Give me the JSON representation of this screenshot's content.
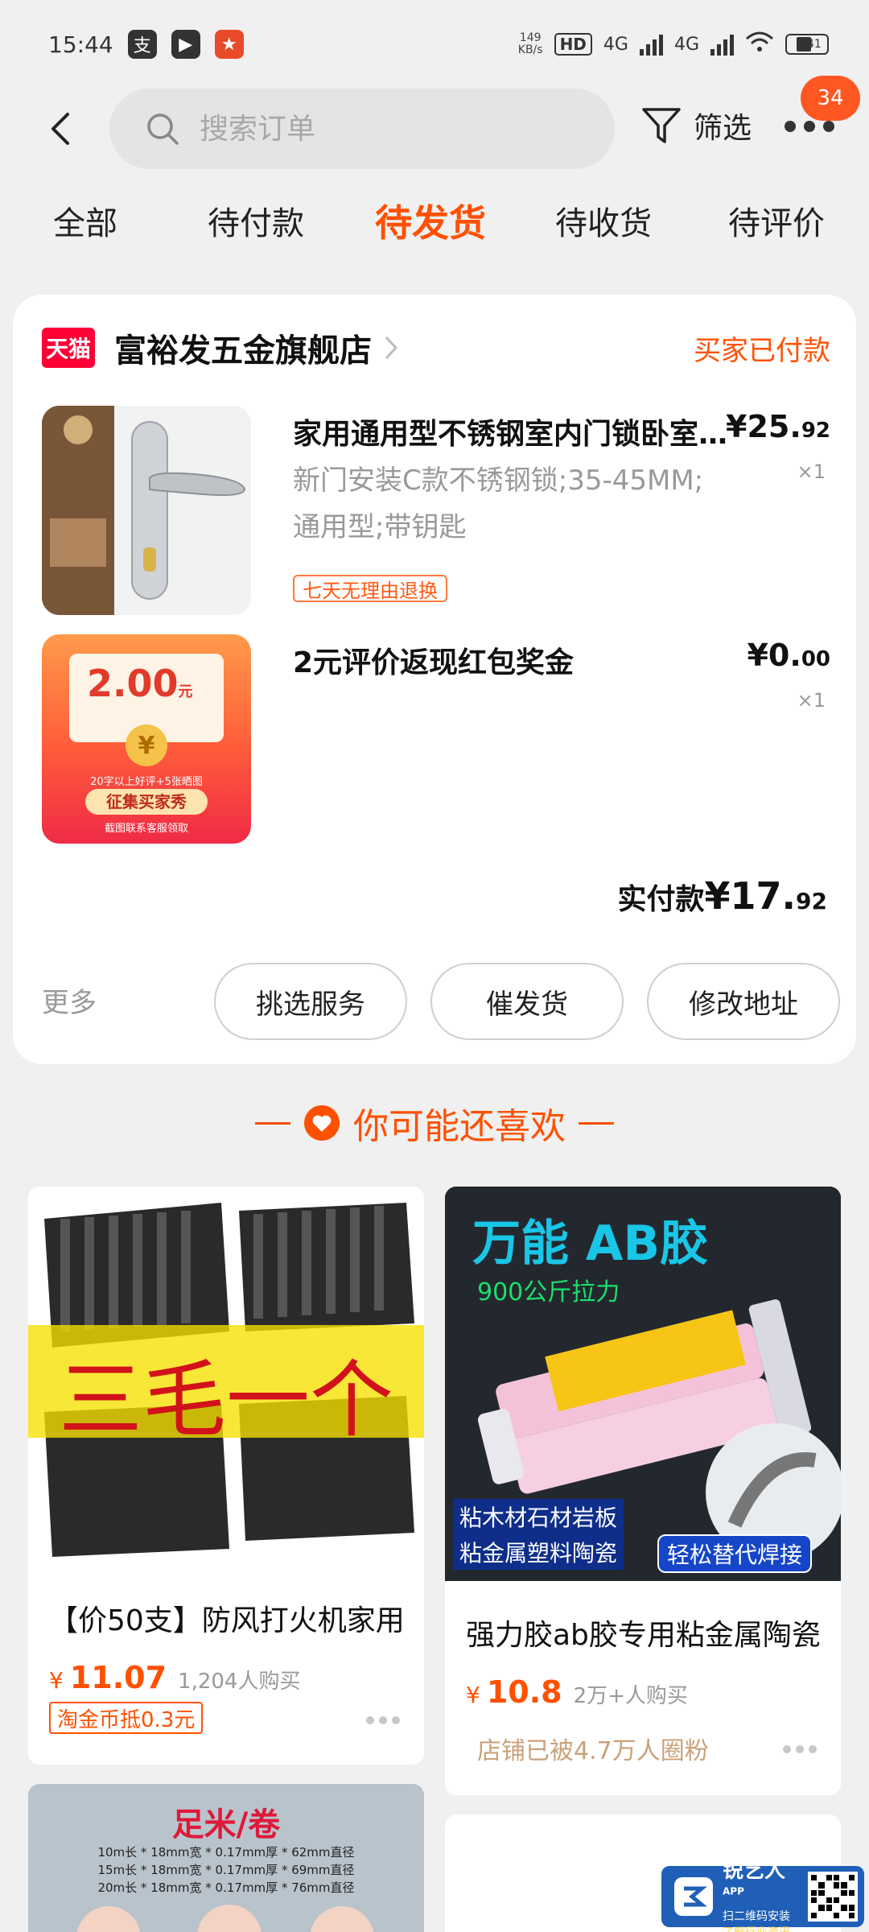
{
  "status_bar": {
    "time": "15:44",
    "app_icons": [
      "alipay-icon",
      "video-play-icon",
      "game-app-icon"
    ],
    "net_speed": "149",
    "net_unit": "KB/s",
    "hd_label": "HD",
    "signal1": "4G",
    "signal2": "4G",
    "battery": "41"
  },
  "header": {
    "search_placeholder": "搜索订单",
    "filter_label": "筛选",
    "badge_count": "34"
  },
  "tabs": [
    {
      "label": "全部"
    },
    {
      "label": "待付款"
    },
    {
      "label": "待发货"
    },
    {
      "label": "待收货"
    },
    {
      "label": "待评价"
    }
  ],
  "order": {
    "platform_badge": "天猫",
    "shop_name": "富裕发五金旗舰店",
    "status": "买家已付款",
    "items": [
      {
        "title": "家用通用型不锈钢室内门锁卧室房门锁",
        "sku_line1": "新门安装C款不锈钢锁;35-45MM;",
        "sku_line2": "通用型;带钥匙",
        "tag": "七天无理由退换",
        "price_main": "¥25.",
        "price_dec": "92",
        "qty": "×1"
      },
      {
        "title": "2元评价返现红包奖金",
        "price_main": "¥0.",
        "price_dec": "00",
        "qty": "×1",
        "redpack_amount": "2.00",
        "redpack_unit": "元",
        "redpack_line1": "20字以上好评+5张晒图",
        "redpack_line2": "征集买家秀",
        "redpack_line3": "截图联系客服领取"
      }
    ],
    "total_label": "实付款",
    "total_main": "¥17.",
    "total_dec": "92",
    "more_label": "更多",
    "actions": [
      "挑选服务",
      "催发货",
      "修改地址"
    ]
  },
  "recommend": {
    "heading": "你可能还喜欢",
    "products": [
      {
        "image_text": "三毛一个",
        "title": "【价50支】防风打火机家用",
        "currency": "¥",
        "price": "11.07",
        "sales": "1,204人购买",
        "tag": "淘金币抵0.3元"
      },
      {
        "image_title": "万能 AB胶",
        "image_sub": "900公斤拉力",
        "image_tag1": "粘木材石材岩板",
        "image_tag2": "粘金属塑料陶瓷",
        "image_tag3": "轻松替代焊接",
        "title": "强力胶ab胶专用粘金属陶瓷",
        "currency": "¥",
        "price": "10.8",
        "sales": "2万+人购买",
        "note": "店铺已被4.7万人圈粉"
      },
      {
        "image_title": "足米/卷",
        "image_line1": "10m长 * 18mm宽 * 0.17mm厚 * 62mm直径",
        "image_line2": "15m长 * 18mm宽 * 0.17mm厚 * 69mm直径",
        "image_line3": "20m长 * 18mm宽 * 0.17mm厚 * 76mm直径"
      }
    ]
  },
  "watermark": {
    "name": "锐艺人",
    "sup": "APP",
    "line1": "扫二维码安装",
    "line2": "了解行业资讯"
  },
  "colors": {
    "accent": "#ff5000",
    "tmall_red": "#ff0036",
    "badge": "#ff5722",
    "background": "#f0f0f0"
  }
}
